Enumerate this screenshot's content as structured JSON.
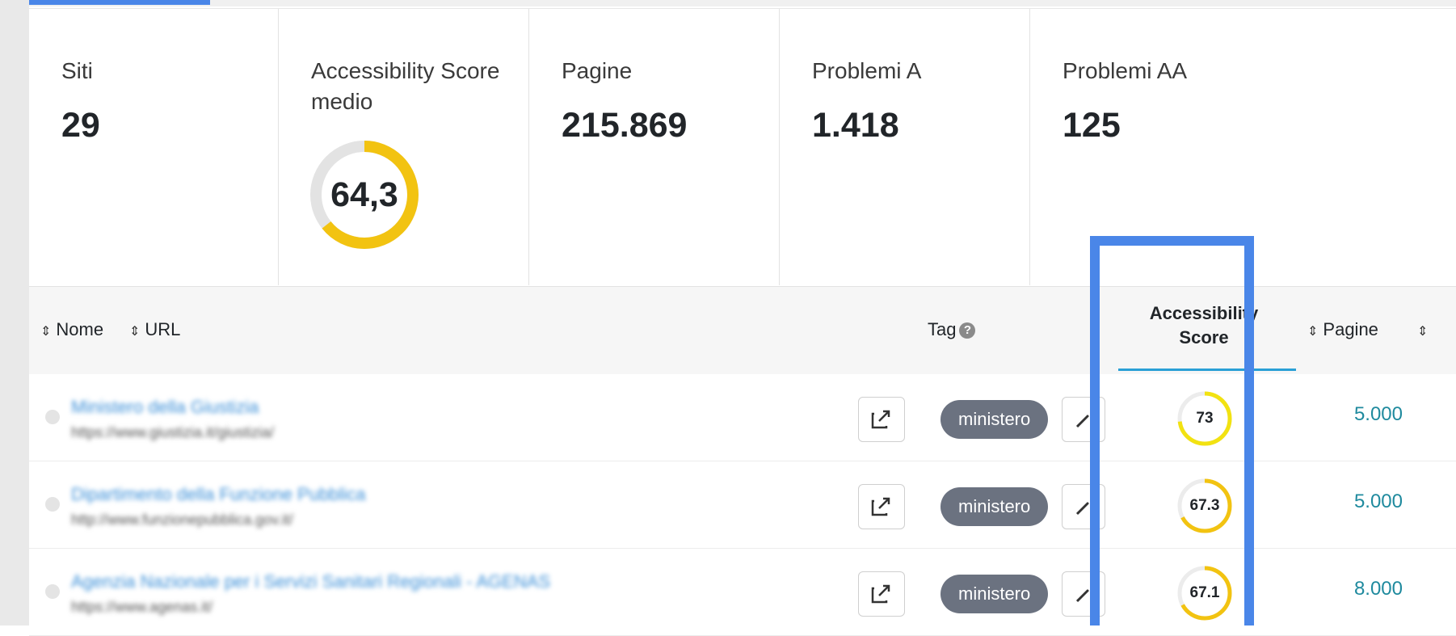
{
  "stats": [
    {
      "label": "Siti",
      "value": "29"
    },
    {
      "label": "Accessibility Score medio",
      "value": "64,3",
      "gauge_fraction": 0.643
    },
    {
      "label": "Pagine",
      "value": "215.869"
    },
    {
      "label": "Problemi A",
      "value": "1.418"
    },
    {
      "label": "Problemi AA",
      "value": "125"
    }
  ],
  "table": {
    "headers": {
      "name": "Nome",
      "url": "URL",
      "tag": "Tag",
      "score_line1": "Accessibility",
      "score_line2": "Score",
      "pages": "Pagine"
    },
    "rows": [
      {
        "name": "Ministero della Giustizia",
        "url": "https://www.giustizia.it/giustizia/",
        "tag": "ministero",
        "score": "73",
        "score_fraction": 0.73,
        "pages": "5.000"
      },
      {
        "name": "Dipartimento della Funzione Pubblica",
        "url": "http://www.funzionepubblica.gov.it/",
        "tag": "ministero",
        "score": "67.3",
        "score_fraction": 0.673,
        "pages": "5.000"
      },
      {
        "name": "Agenzia Nazionale per i Servizi Sanitari Regionali - AGENAS",
        "url": "https://www.agenas.it/",
        "tag": "ministero",
        "score": "67.1",
        "score_fraction": 0.671,
        "pages": "8.000"
      }
    ]
  },
  "colors": {
    "gauge_fill": "#f2c311",
    "gauge_track": "#e3e3e3",
    "highlight": "#4a86e8",
    "tag_bg": "#6b7280",
    "link": "#3b8fd8",
    "pages": "#1f8a9e"
  },
  "icons": {
    "external": "external-link-icon",
    "edit": "pencil-icon",
    "help": "question-circle-icon",
    "sort": "sort-icon"
  }
}
